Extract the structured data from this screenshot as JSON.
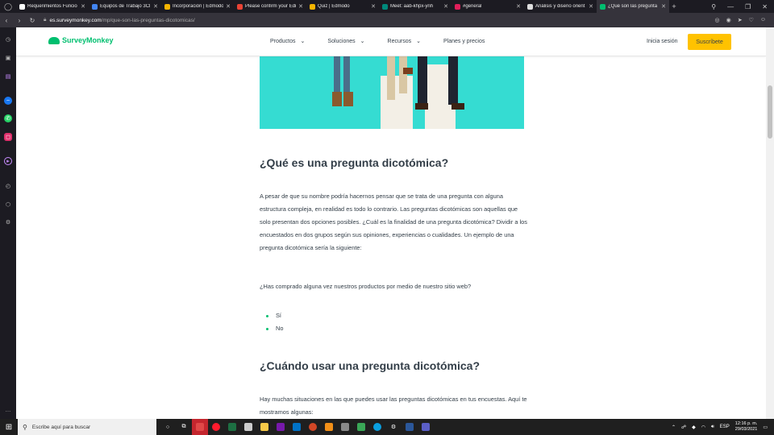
{
  "browser": {
    "tabs": [
      {
        "label": "Requerimientos Funcio",
        "color": "#ffffff"
      },
      {
        "label": "Equipos de Trabajo 3Cl",
        "color": "#4285f4"
      },
      {
        "label": "Incorporación | Edmodo",
        "color": "#f5b400"
      },
      {
        "label": "Please confirm your Edi",
        "color": "#ea4335"
      },
      {
        "label": "Quiz | Edmodo",
        "color": "#f5b400"
      },
      {
        "label": "Meet: aab-khpx-ynh",
        "color": "#00897b"
      },
      {
        "label": "#general",
        "color": "#e01e5a"
      },
      {
        "label": "Análisis y diseño orient",
        "color": "#dddddd"
      },
      {
        "label": "¿Qué son las pregunta",
        "color": "#00bf6f"
      }
    ],
    "new_tab": "+",
    "url_host": "es.surveymonkey.com",
    "url_path": "/mp/que-son-las-preguntas-dicotomicas/"
  },
  "site": {
    "logo": "SurveyMonkey",
    "nav": [
      "Productos",
      "Soluciones",
      "Recursos",
      "Planes y precios"
    ],
    "login": "Inicia sesión",
    "signup": "Suscríbete",
    "brand_color": "#00bf6f",
    "cta_color": "#ffc200"
  },
  "article": {
    "heading1": "¿Qué es una pregunta dicotómica?",
    "paragraph1": "A pesar de que su nombre podría hacernos pensar que se trata de una pregunta con alguna estructura compleja, en realidad es todo lo contrario. Las preguntas dicotómicas son aquellas que solo presentan dos opciones posibles. ¿Cuál es la finalidad de una pregunta dicotómica? Dividir a los encuestados en dos grupos según sus opiniones, experiencias o cualidades. Un ejemplo de una pregunta dicotómica sería la siguiente:",
    "example_question": "¿Has comprado alguna vez nuestros productos por medio de nuestro sitio web?",
    "options": [
      "Sí",
      "No"
    ],
    "heading2": "¿Cuándo usar una pregunta dicotómica?",
    "paragraph2": "Hay muchas situaciones en las que puedes usar las preguntas dicotómicas en tus encuestas. Aquí te mostramos algunas:"
  },
  "taskbar": {
    "search_placeholder": "Escribe aquí para buscar",
    "lang": "ESP",
    "time": "12:16 p. m.",
    "date": "29/03/2021"
  }
}
